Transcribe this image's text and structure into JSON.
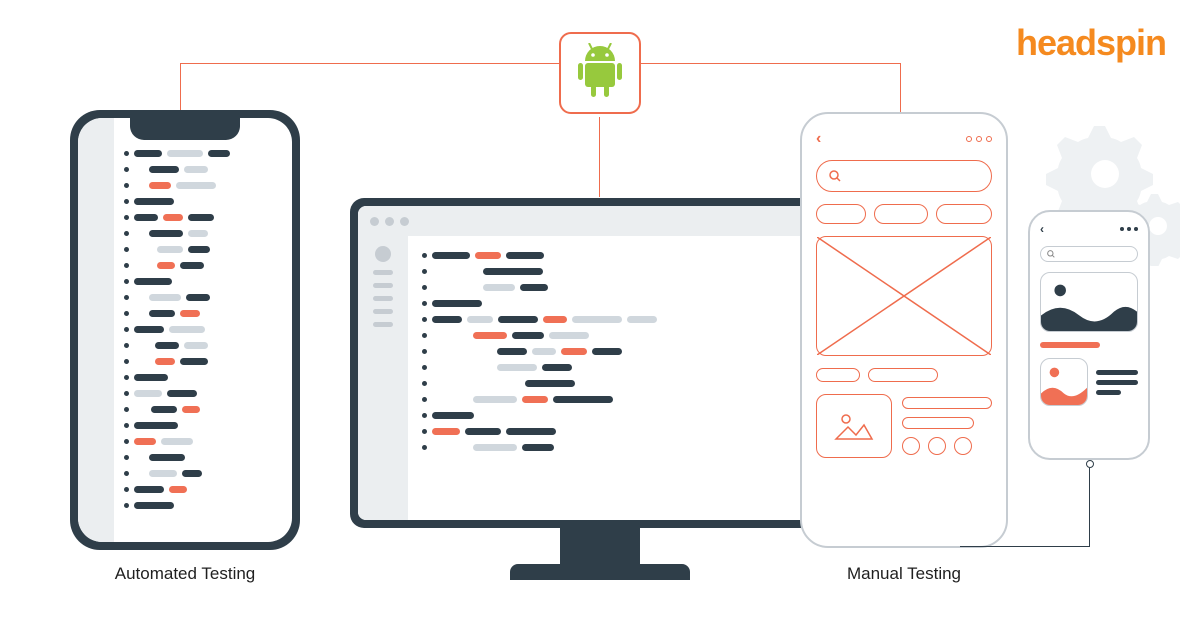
{
  "brand": "headspin",
  "labels": {
    "automated": "Automated Testing",
    "manual": "Manual Testing"
  },
  "icons": {
    "android": "android-robot",
    "search": "Q",
    "back": "‹",
    "image": "image-placeholder"
  },
  "colors": {
    "accent": "#ef6c4d",
    "dark": "#2f3e49",
    "grey": "#d0d7dd",
    "brand": "#f58a1f",
    "android": "#97c93d"
  }
}
